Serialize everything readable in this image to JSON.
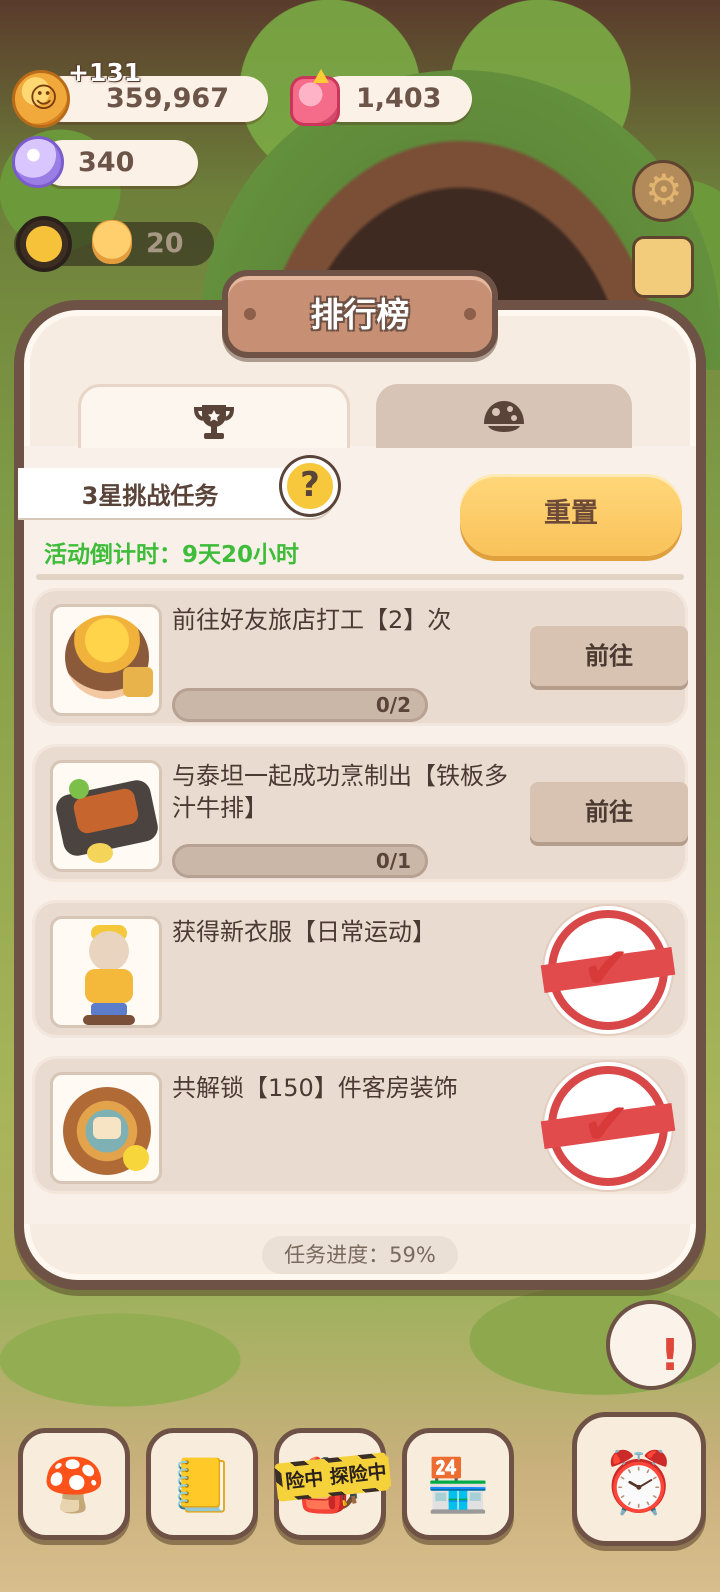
{
  "resources": {
    "cookies": "359,967",
    "cookies_gain": "+131",
    "gems": "1,403",
    "crystals": "340",
    "energy": "20"
  },
  "panel": {
    "title": "排行榜",
    "tabs": [
      {
        "icon": "trophy-icon",
        "active": true
      },
      {
        "icon": "mushroom-icon",
        "active": false
      }
    ],
    "task_header": "3星挑战任务",
    "help_symbol": "?",
    "countdown": "活动倒计时：9天20小时",
    "reset_label": "重置",
    "tasks": [
      {
        "desc": "前往好友旅店打工【2】次",
        "progress": "0/2",
        "progress_fraction": 0,
        "action": "前往",
        "done": false,
        "thumb": "worker-girl"
      },
      {
        "desc": "与泰坦一起成功烹制出【铁板多汁牛排】",
        "progress": "0/1",
        "progress_fraction": 0,
        "action": "前往",
        "done": false,
        "thumb": "steak-plate"
      },
      {
        "desc": "获得新衣服【日常运动】",
        "done": true,
        "check_symbol": "✔",
        "thumb": "outfit-figure"
      },
      {
        "desc": "共解锁【150】件客房装饰",
        "done": true,
        "check_symbol": "✔",
        "thumb": "decor-medal"
      }
    ],
    "overall_progress": "任务进度：59%"
  },
  "bottom_bar": {
    "tape_text": "险中 探险中"
  },
  "colors": {
    "panel_bg": "#f7ece2",
    "panel_border": "#6d5245",
    "countdown_green": "#3fbd3a",
    "reset_yellow": "#f9c25a",
    "stamp_red": "#d94848"
  }
}
